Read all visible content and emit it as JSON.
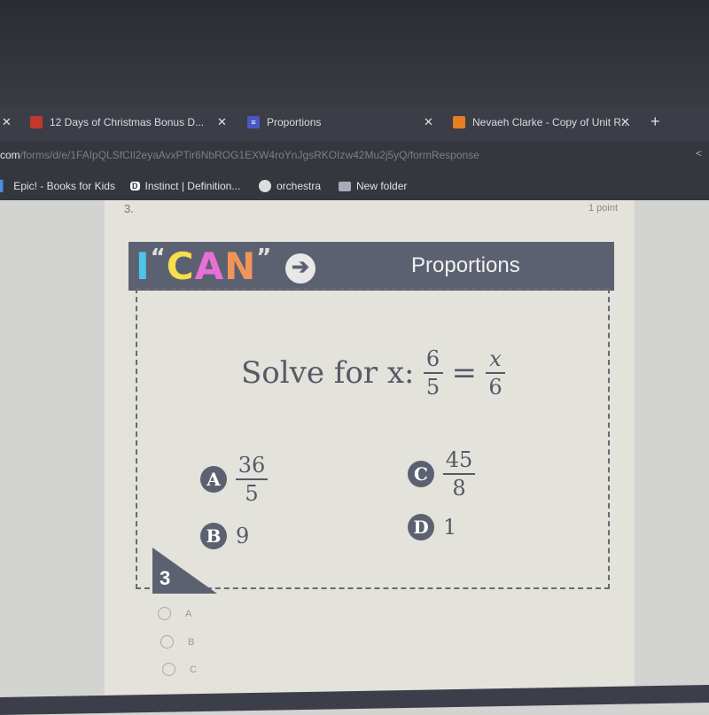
{
  "browser": {
    "tabs": [
      {
        "label": "12 Days of Christmas Bonus D...",
        "icon": "slides-icon",
        "color": "#c0392b"
      },
      {
        "label": "Proportions",
        "icon": "forms-icon",
        "color": "#4a56c8"
      },
      {
        "label": "Nevaeh Clarke - Copy of Unit R...",
        "icon": "slides-icon",
        "color": "#e67e22"
      }
    ],
    "new_tab": "+",
    "close": "✕",
    "url_host": "com",
    "url_path": "/forms/d/e/1FAIpQLSfCIl2eyaAvxPTir6NbROG1EXW4roYnJgsRKOIzw42Mu2j5yQ/formResponse",
    "bookmarks": [
      "Epic! - Books for Kids",
      "Instinct | Definition...",
      "orchestra",
      "New folder"
    ]
  },
  "question": {
    "number": "3.",
    "points": "1 point",
    "banner": {
      "i": "I",
      "open_quote": "“",
      "c": "C",
      "a": "A",
      "n": "N",
      "close_quote": "”",
      "title": "Proportions"
    },
    "prompt": "Solve for x:",
    "lhs": {
      "num": "6",
      "den": "5"
    },
    "eq": "=",
    "rhs": {
      "num": "x",
      "den": "6"
    },
    "options": [
      {
        "letter": "A",
        "num": "36",
        "den": "5"
      },
      {
        "letter": "B",
        "value": "9"
      },
      {
        "letter": "C",
        "num": "45",
        "den": "8"
      },
      {
        "letter": "D",
        "value": "1"
      }
    ],
    "slide_number": "3",
    "choices": [
      "A",
      "B",
      "C"
    ]
  }
}
